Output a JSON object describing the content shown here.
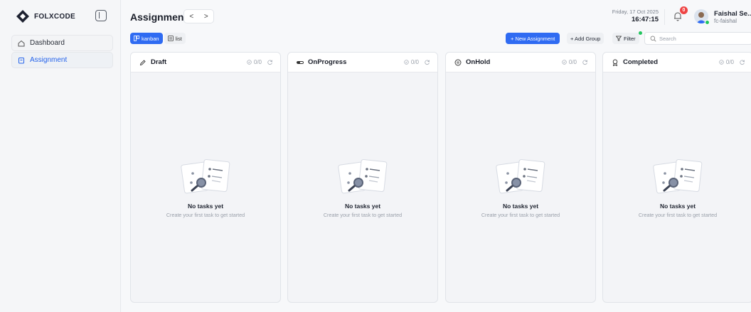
{
  "brand": {
    "name": "FOLXCODE"
  },
  "sidebar": {
    "items": [
      {
        "label": "Dashboard",
        "icon": "home-icon",
        "active": false
      },
      {
        "label": "Assignment",
        "icon": "clipboard-icon",
        "active": true
      }
    ]
  },
  "header": {
    "title": "Assignment",
    "prev": "<",
    "next": ">",
    "date": "Friday, 17 Oct 2025",
    "time": "16:47:15",
    "notification_count": "0",
    "user_name": "Faishal Se...",
    "user_handle": "fc-faishal"
  },
  "toolbar": {
    "views": [
      {
        "label": "kanban",
        "icon": "kanban-icon",
        "active": true
      },
      {
        "label": "list",
        "icon": "list-icon",
        "active": false
      }
    ],
    "new_assignment": "+ New Assignment",
    "add_group": "+ Add Group",
    "filter": "Filter",
    "search_placeholder": "Search"
  },
  "columns": [
    {
      "title": "Draft",
      "icon": "pencil-icon",
      "count": "0/0",
      "empty_title": "No tasks yet",
      "empty_sub": "Create your first task to get started"
    },
    {
      "title": "OnProgress",
      "icon": "progress-icon",
      "count": "0/0",
      "empty_title": "No tasks yet",
      "empty_sub": "Create your first task to get started"
    },
    {
      "title": "OnHold",
      "icon": "pause-circle-icon",
      "count": "0/0",
      "empty_title": "No tasks yet",
      "empty_sub": "Create your first task to get started"
    },
    {
      "title": "Completed",
      "icon": "award-icon",
      "count": "0/0",
      "empty_title": "No tasks yet",
      "empty_sub": "Create your first task to get started"
    }
  ],
  "colors": {
    "accent": "#2f6bf2",
    "online": "#22c55e",
    "badge": "#ef4444"
  }
}
